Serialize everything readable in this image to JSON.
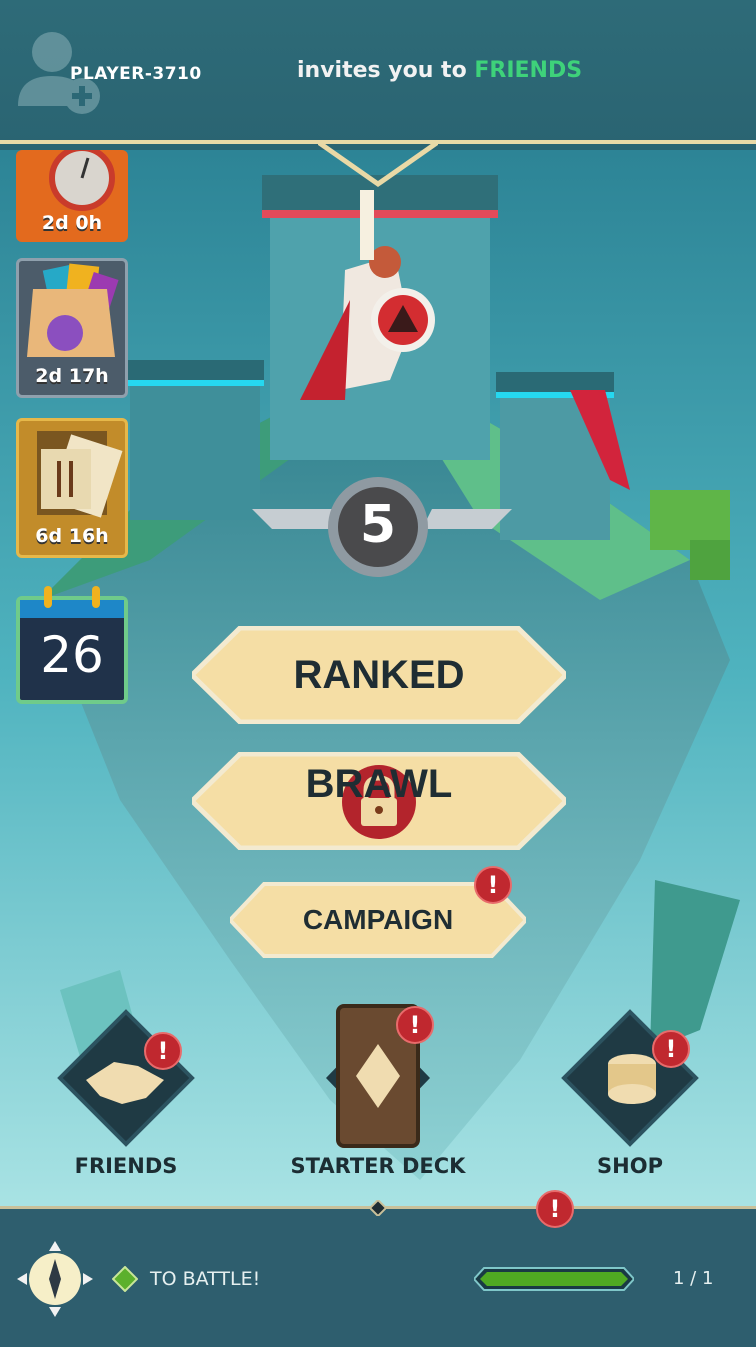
{
  "header": {
    "player_name": "PLAYER-3710",
    "invite_text": "invites you to ",
    "invite_target": "FRIENDS"
  },
  "events": [
    {
      "timer": "2d 0h",
      "icon": "stopwatch-icon"
    },
    {
      "timer": "2d 17h",
      "icon": "shopping-bag-icon"
    },
    {
      "timer": "6d 16h",
      "icon": "card-pack-icon"
    },
    {
      "day": "26",
      "icon": "calendar-icon"
    }
  ],
  "rank": {
    "level": "5"
  },
  "menu": {
    "ranked_label": "RANKED",
    "brawl_label": "BRAWL",
    "campaign_label": "CAMPAIGN",
    "alert_glyph": "!"
  },
  "nav": {
    "friends_label": "FRIENDS",
    "starter_deck_label": "STARTER DECK",
    "shop_label": "SHOP"
  },
  "quest": {
    "label": "TO BATTLE!",
    "progress": 1.0,
    "count": "1 / 1"
  },
  "colors": {
    "invite_green": "#3ed27a",
    "alert_red": "#c0282f",
    "progress_green": "#4faa22",
    "button_cream": "#f7e3b0"
  }
}
